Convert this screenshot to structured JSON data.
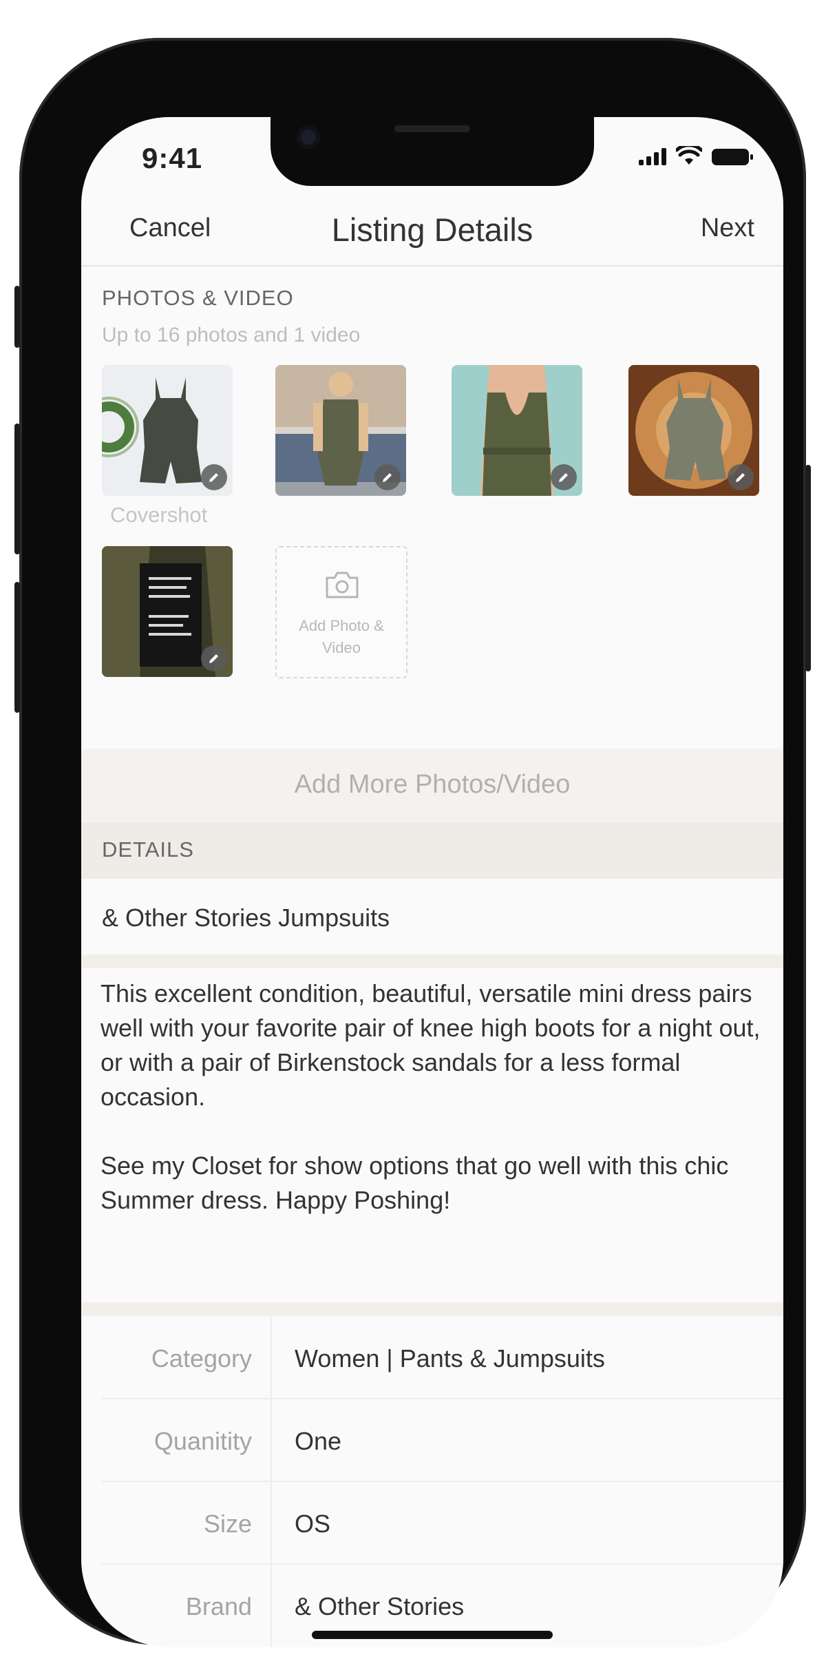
{
  "status_bar": {
    "time": "9:41"
  },
  "nav": {
    "cancel": "Cancel",
    "title": "Listing Details",
    "next": "Next"
  },
  "photos": {
    "section_label": "PHOTOS & VIDEO",
    "subtitle": "Up to 16 photos and 1 video",
    "cover_caption": "Covershot",
    "add_tile_label": "Add Photo & Video",
    "add_more": "Add More Photos/Video"
  },
  "details": {
    "section_label": "DETAILS",
    "title": "& Other Stories Jumpsuits",
    "description_p1": "This excellent condition, beautiful, versatile mini dress pairs well with your favorite pair of knee high boots for a night out, or with a pair of Birkenstock sandals for a less formal occasion.",
    "description_p2": "See my Closet for show options that go well with this chic Summer dress. Happy Poshing!"
  },
  "attributes": [
    {
      "key": "Category",
      "value": "Women | Pants & Jumpsuits"
    },
    {
      "key": "Quanitity",
      "value": "One"
    },
    {
      "key": "Size",
      "value": "OS"
    },
    {
      "key": "Brand",
      "value": "& Other Stories"
    }
  ],
  "colors": {
    "band": "#efebe6",
    "add_more_bg": "#f4f2ee",
    "text": "#333333",
    "muted": "#a4a4a4"
  }
}
